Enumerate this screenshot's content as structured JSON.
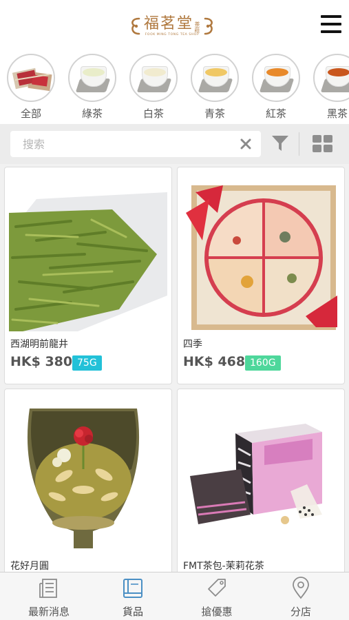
{
  "header": {
    "logo_cn": "福茗堂",
    "logo_sub": "茶莊",
    "logo_en": "FOOK MING TONG TEA SHOP"
  },
  "categories": [
    {
      "label": "全部",
      "icon": "tea-gift-box-icon"
    },
    {
      "label": "綠茶",
      "icon": "green-tea-cup-icon",
      "tea_color": "#e9edc9"
    },
    {
      "label": "白茶",
      "icon": "white-tea-cup-icon",
      "tea_color": "#f1ebcf"
    },
    {
      "label": "青茶",
      "icon": "oolong-tea-cup-icon",
      "tea_color": "#f0c865"
    },
    {
      "label": "紅茶",
      "icon": "black-tea-cup-icon",
      "tea_color": "#e8892a"
    },
    {
      "label": "黑茶",
      "icon": "dark-tea-cup-icon",
      "tea_color": "#c9571e"
    }
  ],
  "search": {
    "placeholder": "搜索"
  },
  "products": [
    {
      "name": "西湖明前龍井",
      "price": "HK$ 380",
      "weight": "75G",
      "badge_color": "#22c1d8"
    },
    {
      "name": "四季",
      "price": "HK$ 468",
      "weight": "160G",
      "badge_color": "#4ed79b"
    },
    {
      "name": "花好月圓",
      "price": "",
      "weight": ""
    },
    {
      "name": "FMT茶包-茉莉花茶",
      "price": "",
      "weight": ""
    }
  ],
  "tabs": [
    {
      "label": "最新消息",
      "icon": "news-icon"
    },
    {
      "label": "貨品",
      "icon": "book-icon",
      "active": true
    },
    {
      "label": "搶優惠",
      "icon": "tag-icon"
    },
    {
      "label": "分店",
      "icon": "location-pin-icon"
    }
  ],
  "colors": {
    "brand_gold": "#b0793f",
    "active_tab": "#4a8fc4",
    "badge_cyan": "#22c1d8",
    "badge_green": "#4ed79b"
  }
}
